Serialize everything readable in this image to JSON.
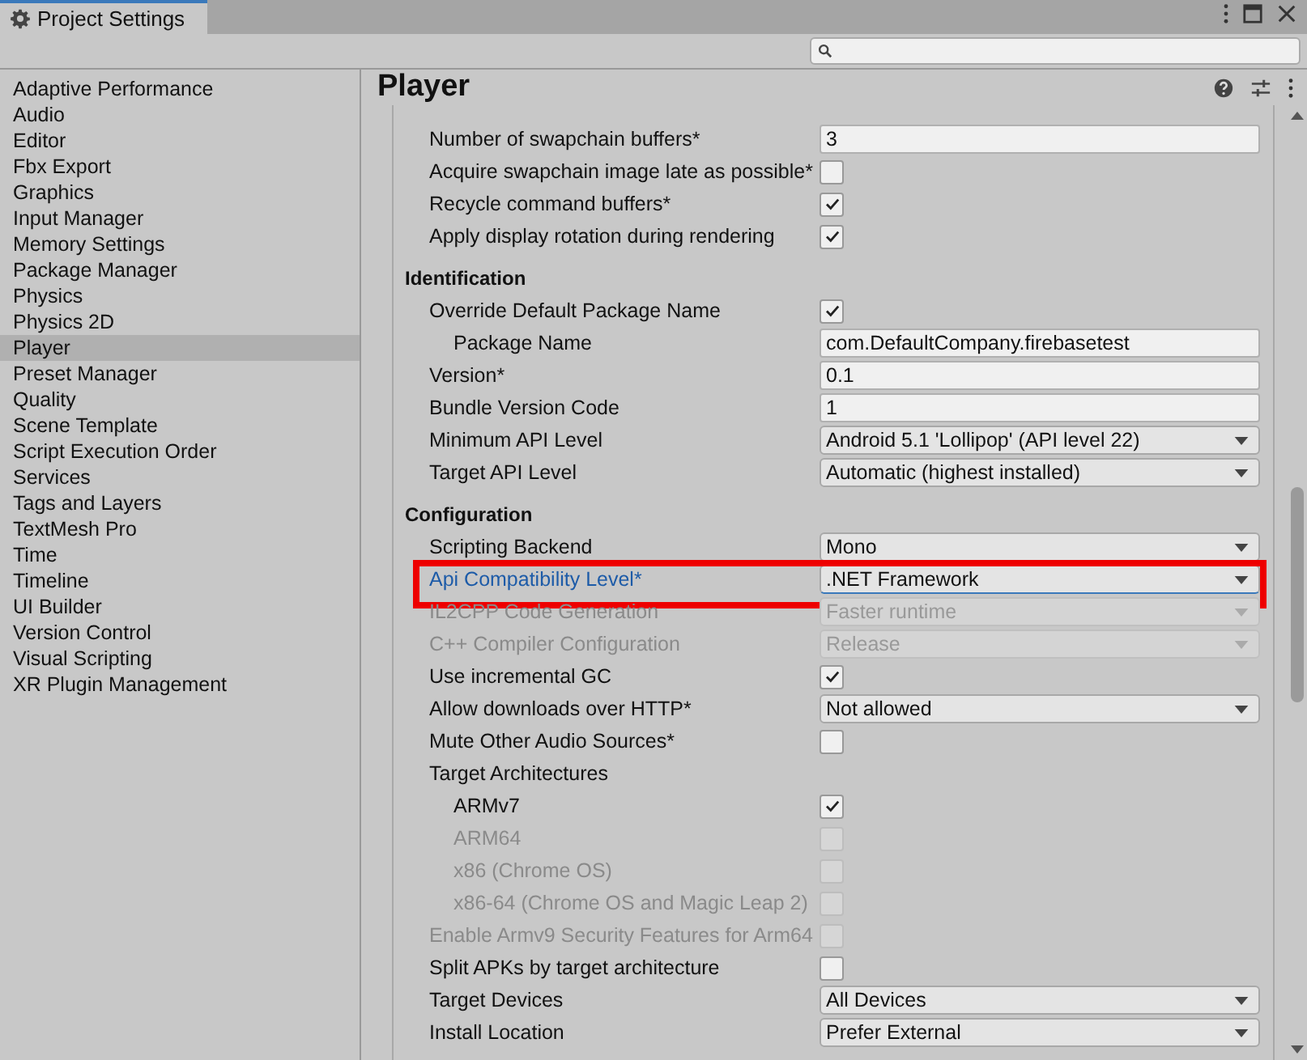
{
  "window": {
    "title": "Project Settings"
  },
  "sidebar": {
    "items": [
      {
        "label": "Adaptive Performance",
        "selected": false
      },
      {
        "label": "Audio",
        "selected": false
      },
      {
        "label": "Editor",
        "selected": false
      },
      {
        "label": "Fbx Export",
        "selected": false
      },
      {
        "label": "Graphics",
        "selected": false
      },
      {
        "label": "Input Manager",
        "selected": false
      },
      {
        "label": "Memory Settings",
        "selected": false
      },
      {
        "label": "Package Manager",
        "selected": false
      },
      {
        "label": "Physics",
        "selected": false
      },
      {
        "label": "Physics 2D",
        "selected": false
      },
      {
        "label": "Player",
        "selected": true
      },
      {
        "label": "Preset Manager",
        "selected": false
      },
      {
        "label": "Quality",
        "selected": false
      },
      {
        "label": "Scene Template",
        "selected": false
      },
      {
        "label": "Script Execution Order",
        "selected": false
      },
      {
        "label": "Services",
        "selected": false
      },
      {
        "label": "Tags and Layers",
        "selected": false
      },
      {
        "label": "TextMesh Pro",
        "selected": false
      },
      {
        "label": "Time",
        "selected": false
      },
      {
        "label": "Timeline",
        "selected": false
      },
      {
        "label": "UI Builder",
        "selected": false
      },
      {
        "label": "Version Control",
        "selected": false
      },
      {
        "label": "Visual Scripting",
        "selected": false
      },
      {
        "label": "XR Plugin Management",
        "selected": false
      }
    ]
  },
  "inspector": {
    "title": "Player",
    "sections": [
      {
        "rows": [
          {
            "kind": "field",
            "label": "Number of swapchain buffers*",
            "value": "3",
            "disabled": false
          },
          {
            "kind": "checkbox",
            "label": "Acquire swapchain image late as possible*",
            "checked": false,
            "disabled": false
          },
          {
            "kind": "checkbox",
            "label": "Recycle command buffers*",
            "checked": true,
            "disabled": false
          },
          {
            "kind": "checkbox",
            "label": "Apply display rotation during rendering",
            "checked": true,
            "disabled": false
          }
        ]
      },
      {
        "title": "Identification",
        "rows": [
          {
            "kind": "checkbox",
            "label": "Override Default Package Name",
            "checked": true,
            "disabled": false,
            "children": [
              {
                "kind": "field",
                "label": "Package Name",
                "value": "com.DefaultCompany.firebasetest",
                "disabled": false
              }
            ]
          },
          {
            "kind": "field",
            "label": "Version*",
            "value": "0.1",
            "disabled": false
          },
          {
            "kind": "field",
            "label": "Bundle Version Code",
            "value": "1",
            "disabled": false
          },
          {
            "kind": "dropdown",
            "label": "Minimum API Level",
            "value": "Android 5.1 'Lollipop' (API level 22)",
            "disabled": false
          },
          {
            "kind": "dropdown",
            "label": "Target API Level",
            "value": "Automatic (highest installed)",
            "disabled": false
          }
        ]
      },
      {
        "title": "Configuration",
        "rows": [
          {
            "kind": "dropdown",
            "label": "Scripting Backend",
            "value": "Mono",
            "disabled": false
          },
          {
            "kind": "dropdown",
            "label": "Api Compatibility Level*",
            "value": ".NET Framework",
            "disabled": false,
            "focused": true,
            "highlighted": true
          },
          {
            "kind": "dropdown",
            "label": "IL2CPP Code Generation",
            "value": "Faster runtime",
            "disabled": true
          },
          {
            "kind": "dropdown",
            "label": "C++ Compiler Configuration",
            "value": "Release",
            "disabled": true
          },
          {
            "kind": "checkbox",
            "label": "Use incremental GC",
            "checked": true,
            "disabled": false
          },
          {
            "kind": "dropdown",
            "label": "Allow downloads over HTTP*",
            "value": "Not allowed",
            "disabled": false
          },
          {
            "kind": "checkbox",
            "label": "Mute Other Audio Sources*",
            "checked": false,
            "disabled": false
          },
          {
            "kind": "label",
            "label": "Target Architectures",
            "disabled": false,
            "children": [
              {
                "kind": "checkbox",
                "label": "ARMv7",
                "checked": true,
                "disabled": false
              },
              {
                "kind": "checkbox",
                "label": "ARM64",
                "checked": false,
                "disabled": true
              },
              {
                "kind": "checkbox",
                "label": "x86 (Chrome OS)",
                "checked": false,
                "disabled": true
              },
              {
                "kind": "checkbox",
                "label": "x86-64 (Chrome OS and Magic Leap 2)",
                "checked": false,
                "disabled": true
              }
            ]
          },
          {
            "kind": "checkbox",
            "label": "Enable Armv9 Security Features for Arm64",
            "checked": false,
            "disabled": true
          },
          {
            "kind": "checkbox",
            "label": "Split APKs by target architecture",
            "checked": false,
            "disabled": false
          },
          {
            "kind": "dropdown",
            "label": "Target Devices",
            "value": "All Devices",
            "disabled": false
          },
          {
            "kind": "dropdown",
            "label": "Install Location",
            "value": "Prefer External",
            "disabled": false
          }
        ]
      }
    ]
  }
}
